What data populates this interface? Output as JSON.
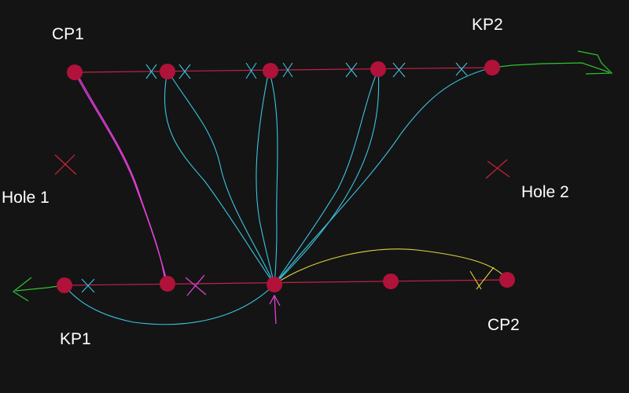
{
  "labels": {
    "cp1": "CP1",
    "kp2": "KP2",
    "hole1": "Hole 1",
    "hole2": "Hole 2",
    "kp1": "KP1",
    "cp2": "CP2"
  },
  "colors": {
    "background": "#141414",
    "node": "#b0123a",
    "rail": "#c0234a",
    "cyan": "#3ac4e0",
    "magenta": "#e040d8",
    "yellow": "#e0d240",
    "green": "#2fc42f",
    "hole_marker": "#d0223c",
    "label_text": "#ffffff"
  }
}
